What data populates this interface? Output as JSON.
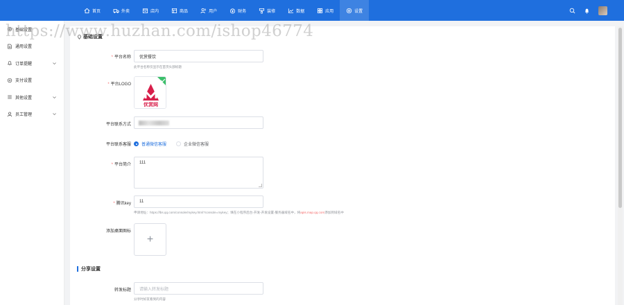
{
  "topnav": {
    "items": [
      {
        "label": "首页",
        "icon": "home-icon"
      },
      {
        "label": "外卖",
        "icon": "delivery-icon"
      },
      {
        "label": "店内",
        "icon": "store-icon"
      },
      {
        "label": "商品",
        "icon": "goods-icon"
      },
      {
        "label": "用户",
        "icon": "users-icon"
      },
      {
        "label": "财务",
        "icon": "finance-icon"
      },
      {
        "label": "装修",
        "icon": "decorate-icon"
      },
      {
        "label": "数据",
        "icon": "chart-icon"
      },
      {
        "label": "应用",
        "icon": "apps-icon"
      },
      {
        "label": "设置",
        "icon": "settings-icon"
      }
    ],
    "active_index": 9
  },
  "sidebar": {
    "items": [
      {
        "label": "基础设置",
        "icon": "gear-icon",
        "has_chevron": false
      },
      {
        "label": "通用设置",
        "icon": "doc-icon",
        "has_chevron": false
      },
      {
        "label": "订单提醒",
        "icon": "bell-icon",
        "has_chevron": true
      },
      {
        "label": "支付设置",
        "icon": "pay-icon",
        "has_chevron": false
      },
      {
        "label": "其他设置",
        "icon": "list-icon",
        "has_chevron": true
      },
      {
        "label": "员工管理",
        "icon": "user-icon",
        "has_chevron": true
      }
    ]
  },
  "watermark": "https://www.huzhan.com/ishop46774",
  "form": {
    "section_basic": "基础设置",
    "platform_name": {
      "label": "平台名称",
      "value": "优赏餐饮",
      "help": "此平台名称仅显示在首页头部标题"
    },
    "platform_logo": {
      "label": "平台LOGO",
      "logo_text": "优赏网"
    },
    "contact": {
      "label": "平台联系方式"
    },
    "service": {
      "label": "平台联系客服",
      "options": [
        "普通微信客服",
        "企业微信客服"
      ],
      "selected": 0
    },
    "intro": {
      "label": "平台简介",
      "value": "111"
    },
    "tencent_key": {
      "label": "腾讯key",
      "value": "11",
      "help_prefix": "申请地址：https://lbs.qq.com/console/mykey.html?console=mykey；填在小程序后台-开发-开发设置-服务器域名中，将",
      "help_link": "apis.map.qq.com",
      "help_suffix": "添加到域名中"
    },
    "add_desktop_icon": {
      "label": "添加桌面图标"
    },
    "section_share": "分享设置",
    "share_title": {
      "label": "转发标题",
      "placeholder": "请输入转发标题",
      "help": "分享时好友看到的内容"
    }
  },
  "colors": {
    "primary": "#1f6fde",
    "required": "#f56c6c"
  }
}
